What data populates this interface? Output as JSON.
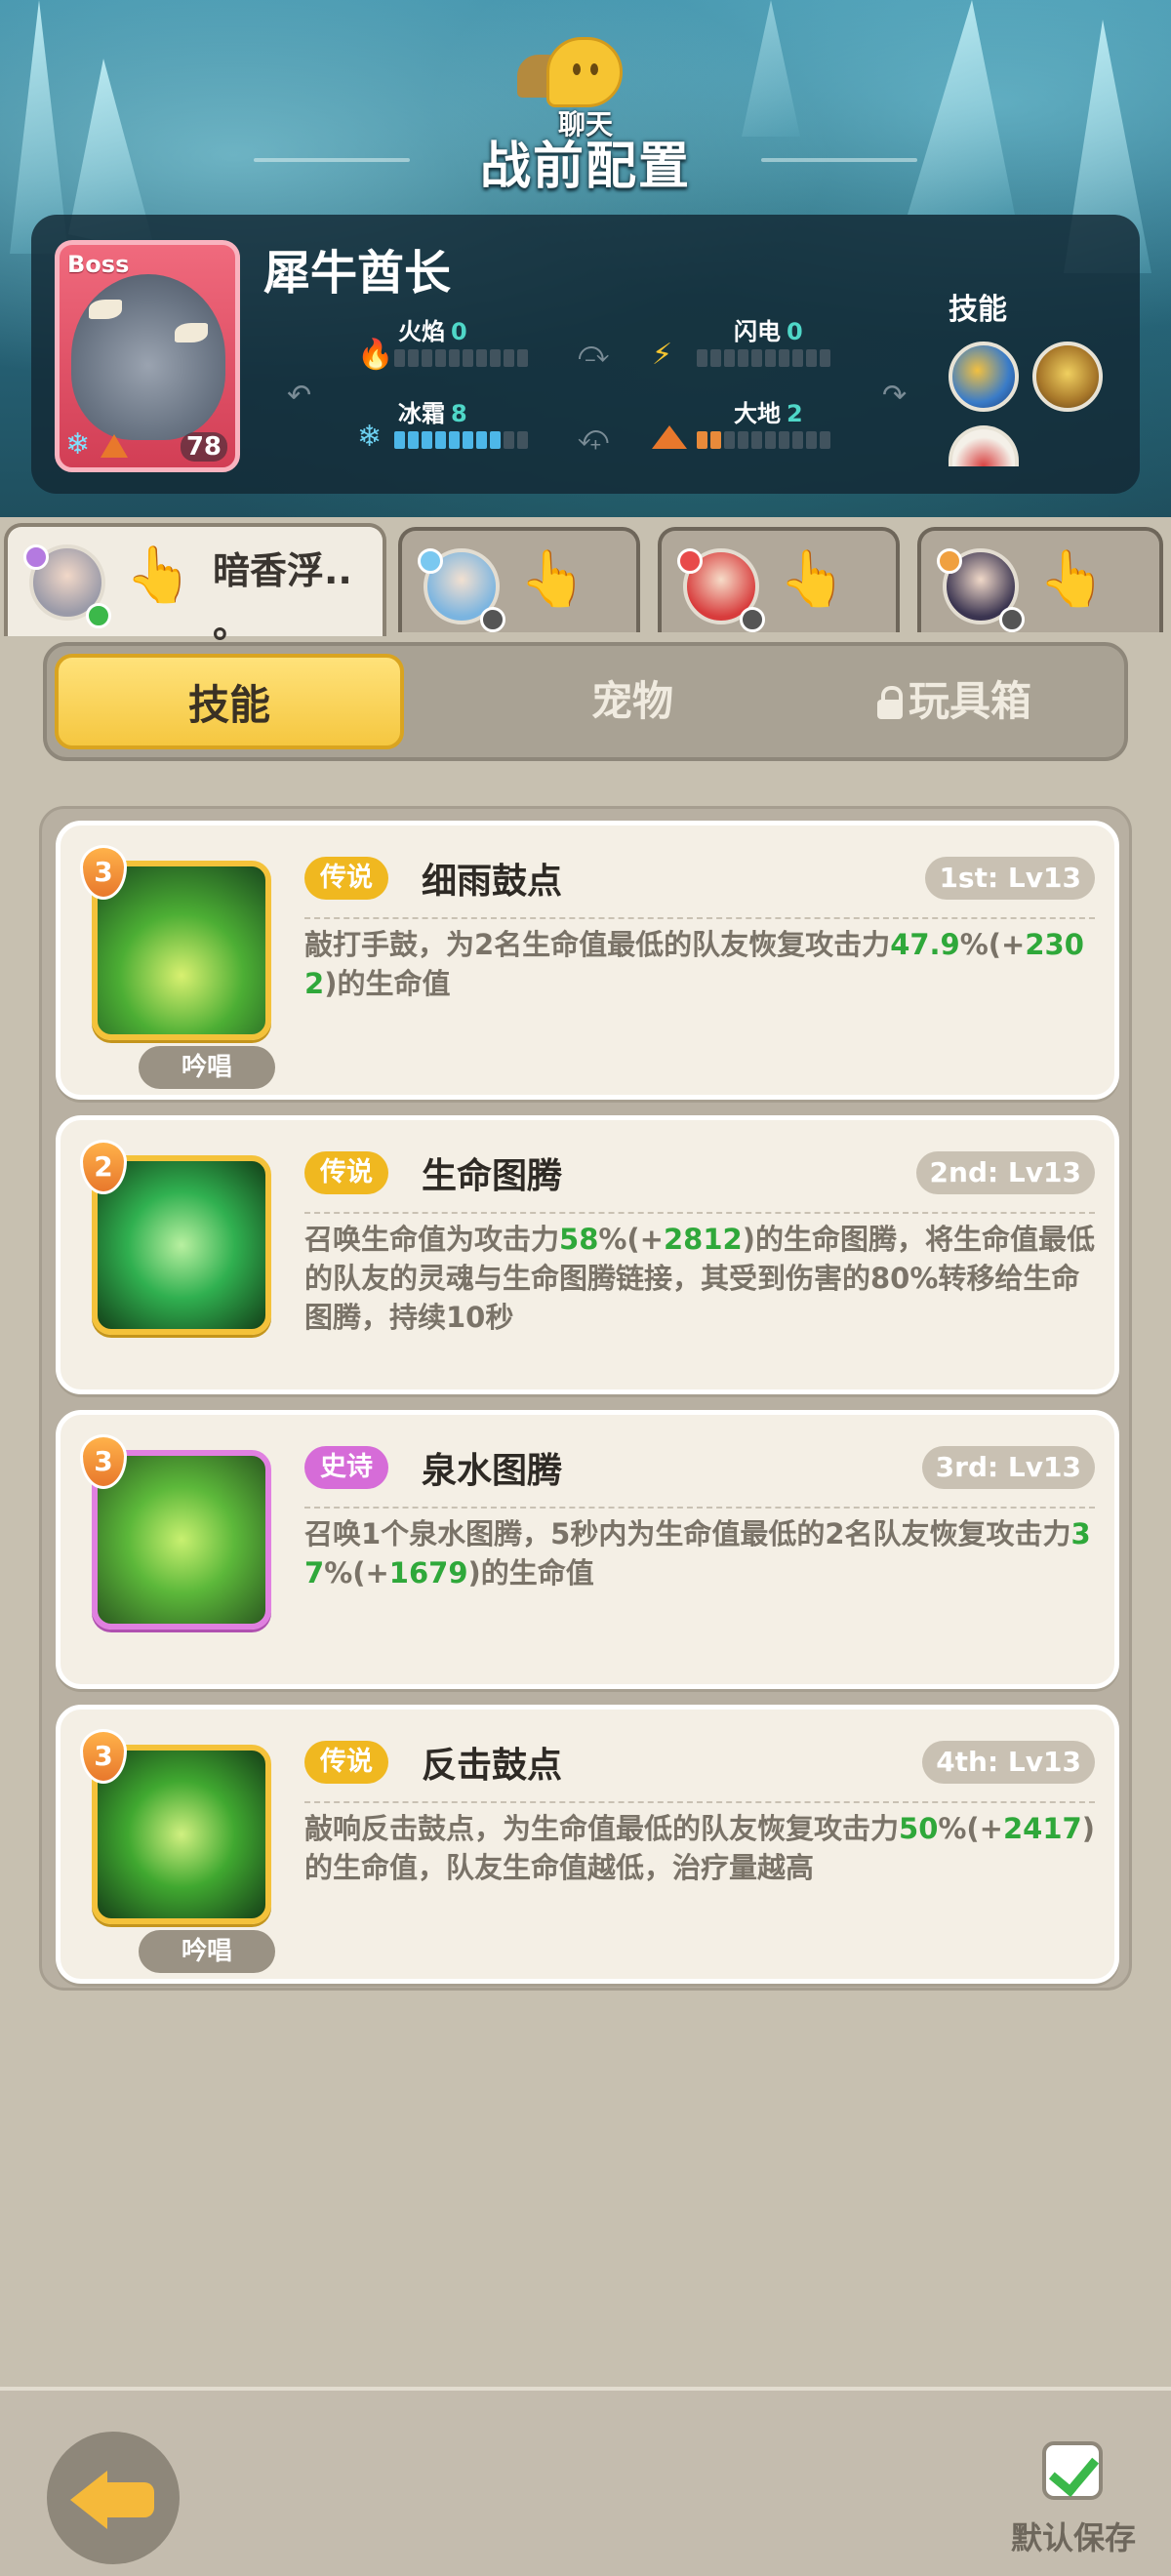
{
  "header": {
    "chat_label": "聊天",
    "title": "战前配置"
  },
  "boss": {
    "tag": "Boss",
    "level": "78",
    "name": "犀牛酋长",
    "elements": {
      "fire": {
        "label": "火焰",
        "value": "0",
        "filled": 0
      },
      "lightning": {
        "label": "闪电",
        "value": "0",
        "filled": 0
      },
      "frost": {
        "label": "冰霜",
        "value": "8",
        "filled": 8
      },
      "earth": {
        "label": "大地",
        "value": "2",
        "filled": 2
      }
    },
    "skills_label": "技能",
    "skill_badges": [
      "6",
      "6"
    ]
  },
  "hero_tabs": [
    {
      "name": "暗香浮..\n。",
      "active": true
    },
    {
      "name": "",
      "active": false
    },
    {
      "name": "",
      "active": false
    },
    {
      "name": "",
      "active": false
    }
  ],
  "category_tabs": {
    "skills": "技能",
    "pets": "宠物",
    "toybox": "玩具箱"
  },
  "skills": [
    {
      "rank": "3",
      "rarity": "传说",
      "name": "细雨鼓点",
      "slot": "1st: Lv13",
      "desc_pre": "敲打手鼓，为2名生命值最低的队友恢复攻击力",
      "desc_num1": "47.9",
      "desc_mid": "%(+",
      "desc_num2": "2302",
      "desc_post": ")的生命值",
      "chant": "吟唱"
    },
    {
      "rank": "2",
      "rarity": "传说",
      "name": "生命图腾",
      "slot": "2nd: Lv13",
      "desc_pre": "召唤生命值为攻击力",
      "desc_num1": "58",
      "desc_mid": "%(+",
      "desc_num2": "2812",
      "desc_post": ")的生命图腾，将生命值最低的队友的灵魂与生命图腾链接，其受到伤害的80%转移给生命图腾，持续10秒",
      "chant": ""
    },
    {
      "rank": "3",
      "rarity": "史诗",
      "name": "泉水图腾",
      "slot": "3rd: Lv13",
      "desc_pre": "召唤1个泉水图腾，5秒内为生命值最低的2名队友恢复攻击力",
      "desc_num1": "37",
      "desc_mid": "%(+",
      "desc_num2": "1679",
      "desc_post": ")的生命值",
      "chant": ""
    },
    {
      "rank": "3",
      "rarity": "传说",
      "name": "反击鼓点",
      "slot": "4th: Lv13",
      "desc_pre": "敲响反击鼓点，为生命值最低的队友恢复攻击力",
      "desc_num1": "50",
      "desc_mid": "%(+",
      "desc_num2": "2417",
      "desc_post": ")的生命值，队友生命值越低，治疗量越高",
      "chant": "吟唱"
    }
  ],
  "footer": {
    "save_label": "默认保存"
  },
  "colors": {
    "legend": "#f0b820",
    "epic": "#d66cd8",
    "highlight_number": "#2fa83a",
    "tab_active": "#f5c740"
  },
  "icons": {
    "back": "back-arrow-icon",
    "save": "checkbox-checked-icon",
    "lock": "lock-icon"
  }
}
